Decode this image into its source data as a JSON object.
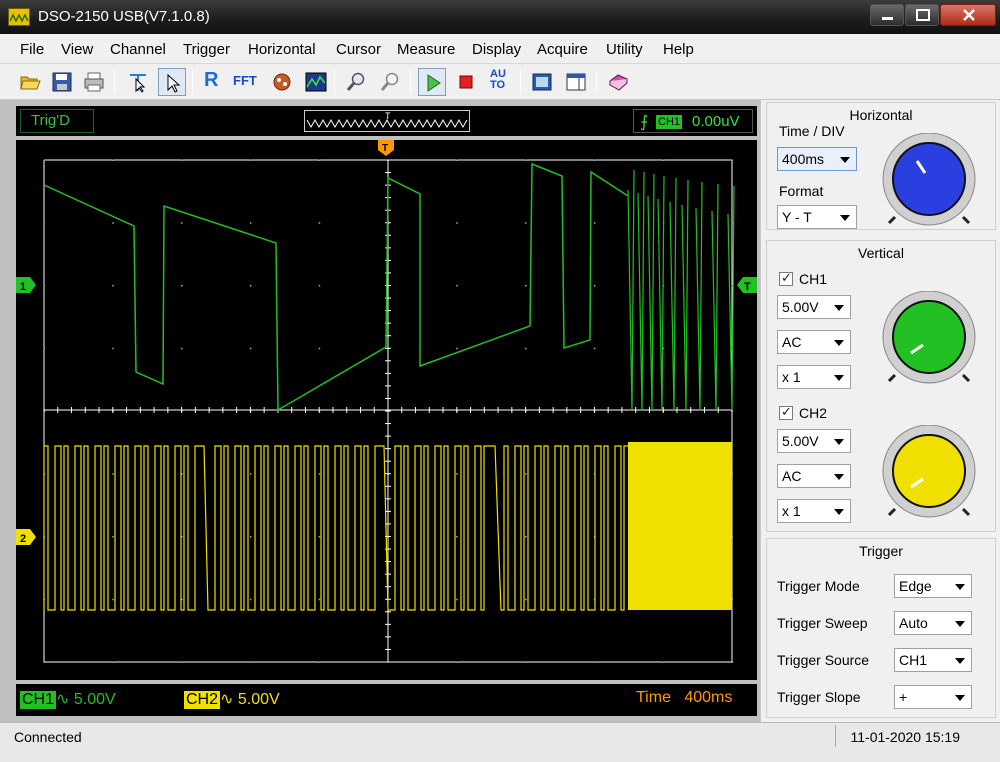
{
  "window": {
    "title": "DSO-2150 USB(V7.1.0.8)"
  },
  "menu": [
    "File",
    "View",
    "Channel",
    "Trigger",
    "Horizontal",
    "Cursor",
    "Measure",
    "Display",
    "Acquire",
    "Utility",
    "Help"
  ],
  "toolbar": {
    "icons": [
      "open-icon",
      "save-icon",
      "print-icon",
      "cursor-select-icon",
      "pointer-icon",
      "reference-icon",
      "fft-icon",
      "math-icon",
      "persistence-icon",
      "zoom-in-icon",
      "zoom-out-icon",
      "run-icon",
      "stop-icon",
      "auto-icon",
      "fit-screen-icon",
      "window-icon",
      "book-icon"
    ],
    "r_label": "R",
    "fft_label": "FFT",
    "auto_label_top": "AU",
    "auto_label_bottom": "TO"
  },
  "scope": {
    "trig_state": "Trig'D",
    "trig_edge_symbol": "⨍",
    "trig_channel": "CH1",
    "trig_level": "0.00uV",
    "trig_marker": "T",
    "ch1_marker": "1",
    "ch2_marker": "2",
    "level_marker": "T",
    "ch1_label": "CH1",
    "ch1_coupling_symbol": "∿",
    "ch1_volts": "5.00V",
    "ch2_label": "CH2",
    "ch2_coupling_symbol": "∿",
    "ch2_volts": "5.00V",
    "time_label": "Time",
    "time_value": "400ms",
    "colors": {
      "ch1": "#22c022",
      "ch2": "#f0e000",
      "trigger": "#ff9900",
      "grid": "#ffffff",
      "text": "#ff9900"
    }
  },
  "panel": {
    "horizontal": {
      "title": "Horizontal",
      "time_div_label": "Time / DIV",
      "time_div_value": "400ms",
      "format_label": "Format",
      "format_value": "Y - T",
      "knob_color": "#2a3fe0"
    },
    "vertical": {
      "title": "Vertical",
      "ch1": {
        "label": "CH1",
        "checked": true,
        "volts": "5.00V",
        "coupling": "AC",
        "probe": "x 1",
        "knob_color": "#22c022"
      },
      "ch2": {
        "label": "CH2",
        "checked": true,
        "volts": "5.00V",
        "coupling": "AC",
        "probe": "x 1",
        "knob_color": "#f0e000"
      }
    },
    "trigger": {
      "title": "Trigger",
      "mode_label": "Trigger Mode",
      "mode_value": "Edge",
      "sweep_label": "Trigger Sweep",
      "sweep_value": "Auto",
      "source_label": "Trigger Source",
      "source_value": "CH1",
      "slope_label": "Trigger Slope",
      "slope_value": "+"
    }
  },
  "status": {
    "connection": "Connected",
    "datetime": "11-01-2020  15:19"
  }
}
